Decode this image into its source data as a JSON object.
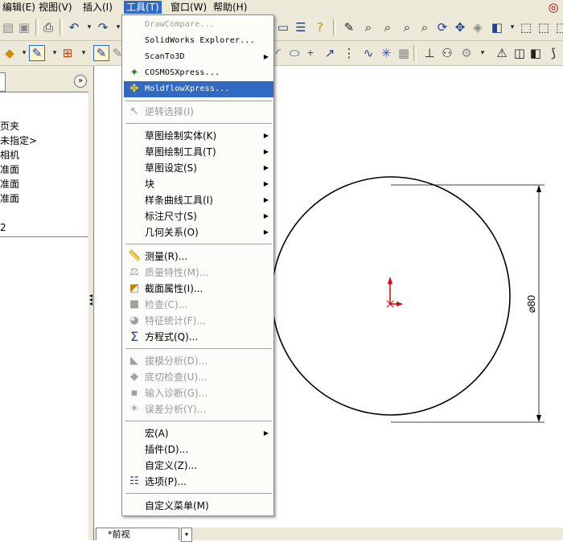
{
  "menubar": [
    {
      "label": "编辑(E)",
      "active": false
    },
    {
      "label": "视图(V)",
      "active": false
    },
    {
      "label": "插入(I)",
      "active": false
    },
    {
      "label": "工具(T)",
      "active": true
    },
    {
      "label": "窗口(W)",
      "active": false
    },
    {
      "label": "帮助(H)",
      "active": false
    }
  ],
  "tree": {
    "items": [
      "页夹",
      "未指定>",
      "相机",
      "准面",
      "准面",
      "准面",
      "2"
    ],
    "collapse_glyph": "»"
  },
  "tools_menu": {
    "items": [
      {
        "label": "DrawCompare...",
        "icon": "",
        "mono": true,
        "disabled": true
      },
      {
        "label": "SolidWorks Explorer...",
        "icon": "",
        "mono": true
      },
      {
        "label": "ScanTo3D",
        "icon": "",
        "mono": true,
        "submenu": true
      },
      {
        "label": "COSMOSXpress...",
        "icon": "cosmos-icon",
        "mono": true
      },
      {
        "label": "MoldflowXpress...",
        "icon": "moldflow-icon",
        "mono": true,
        "highlighted": true
      },
      {
        "label": "逆转选择(I)",
        "icon": "reverse-select-icon",
        "disabled": true
      },
      {
        "label": "草图绘制实体(K)",
        "icon": "",
        "submenu": true
      },
      {
        "label": "草图绘制工具(T)",
        "icon": "",
        "submenu": true
      },
      {
        "label": "草图设定(S)",
        "icon": "",
        "submenu": true
      },
      {
        "label": "块",
        "icon": "",
        "submenu": true
      },
      {
        "label": "样条曲线工具(I)",
        "icon": "",
        "submenu": true
      },
      {
        "label": "标注尺寸(S)",
        "icon": "",
        "submenu": true
      },
      {
        "label": "几何关系(O)",
        "icon": "",
        "submenu": true
      },
      {
        "label": "测量(R)...",
        "icon": "measure-icon"
      },
      {
        "label": "质量特性(M)...",
        "icon": "mass-properties-icon",
        "disabled": true
      },
      {
        "label": "截面属性(I)...",
        "icon": "section-properties-icon"
      },
      {
        "label": "检查(C)...",
        "icon": "check-icon",
        "disabled": true
      },
      {
        "label": "特征统计(F)...",
        "icon": "feature-statistics-icon",
        "disabled": true
      },
      {
        "label": "方程式(Q)...",
        "icon": "equations-icon"
      },
      {
        "label": "拔模分析(D)...",
        "icon": "draft-analysis-icon",
        "disabled": true
      },
      {
        "label": "底切检查(U)...",
        "icon": "undercut-icon",
        "disabled": true
      },
      {
        "label": "输入诊断(G)...",
        "icon": "import-diagnostics-icon",
        "disabled": true
      },
      {
        "label": "误差分析(Y)...",
        "icon": "deviation-analysis-icon",
        "disabled": true
      },
      {
        "label": "宏(A)",
        "icon": "",
        "submenu": true
      },
      {
        "label": "插件(D)...",
        "icon": ""
      },
      {
        "label": "自定义(Z)...",
        "icon": ""
      },
      {
        "label": "选项(P)...",
        "icon": "options-icon"
      },
      {
        "label": "自定义菜单(M)",
        "icon": ""
      }
    ]
  },
  "drawing": {
    "dimension_label": "⌀80"
  },
  "view_tab": {
    "label": "*前视"
  },
  "colors": {
    "highlight": "#316ac5",
    "chrome": "#ece9d8",
    "sketch_origin": "#e00000"
  }
}
